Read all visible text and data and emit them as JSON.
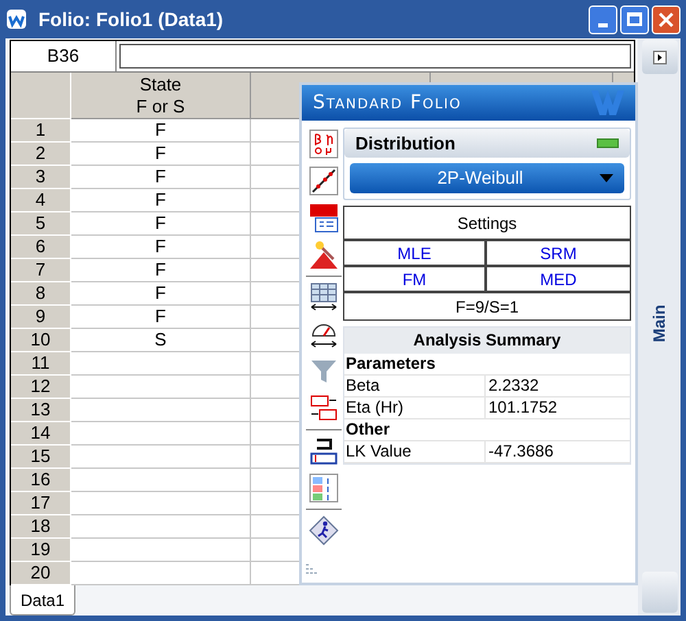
{
  "window": {
    "title": "Folio: Folio1 (Data1)"
  },
  "formula_bar": {
    "cell": "B36"
  },
  "table": {
    "columns": [
      {
        "label": "State\nF or S"
      }
    ],
    "rows": [
      {
        "number": "1",
        "state": "F"
      },
      {
        "number": "2",
        "state": "F"
      },
      {
        "number": "3",
        "state": "F"
      },
      {
        "number": "4",
        "state": "F"
      },
      {
        "number": "5",
        "state": "F"
      },
      {
        "number": "6",
        "state": "F"
      },
      {
        "number": "7",
        "state": "F"
      },
      {
        "number": "8",
        "state": "F"
      },
      {
        "number": "9",
        "state": "F"
      },
      {
        "number": "10",
        "state": "S"
      },
      {
        "number": "11"
      },
      {
        "number": "12"
      },
      {
        "number": "13"
      },
      {
        "number": "14"
      },
      {
        "number": "15"
      },
      {
        "number": "16"
      },
      {
        "number": "17"
      },
      {
        "number": "18"
      },
      {
        "number": "19"
      },
      {
        "number": "20"
      }
    ]
  },
  "panel": {
    "title": "Standard Folio",
    "distribution_label": "Distribution",
    "distribution": "2P-Weibull",
    "settings": {
      "title": "Settings",
      "options": [
        {
          "label": "MLE"
        },
        {
          "label": "SRM"
        },
        {
          "label": "FM"
        },
        {
          "label": "MED"
        }
      ],
      "summary": "F=9/S=1"
    },
    "analysis": {
      "title": "Analysis Summary",
      "sections": [
        {
          "title": "Parameters",
          "rows": [
            {
              "label": "Beta",
              "value": "2.2332"
            },
            {
              "label": "Eta (Hr)",
              "value": "101.1752"
            }
          ]
        },
        {
          "title": "Other",
          "rows": [
            {
              "label": "LK Value",
              "value": "-47.3686"
            }
          ]
        }
      ]
    }
  },
  "side_tab": {
    "label": "Main"
  },
  "sheet_tabs": [
    {
      "label": "Data1",
      "selected": true
    }
  ]
}
